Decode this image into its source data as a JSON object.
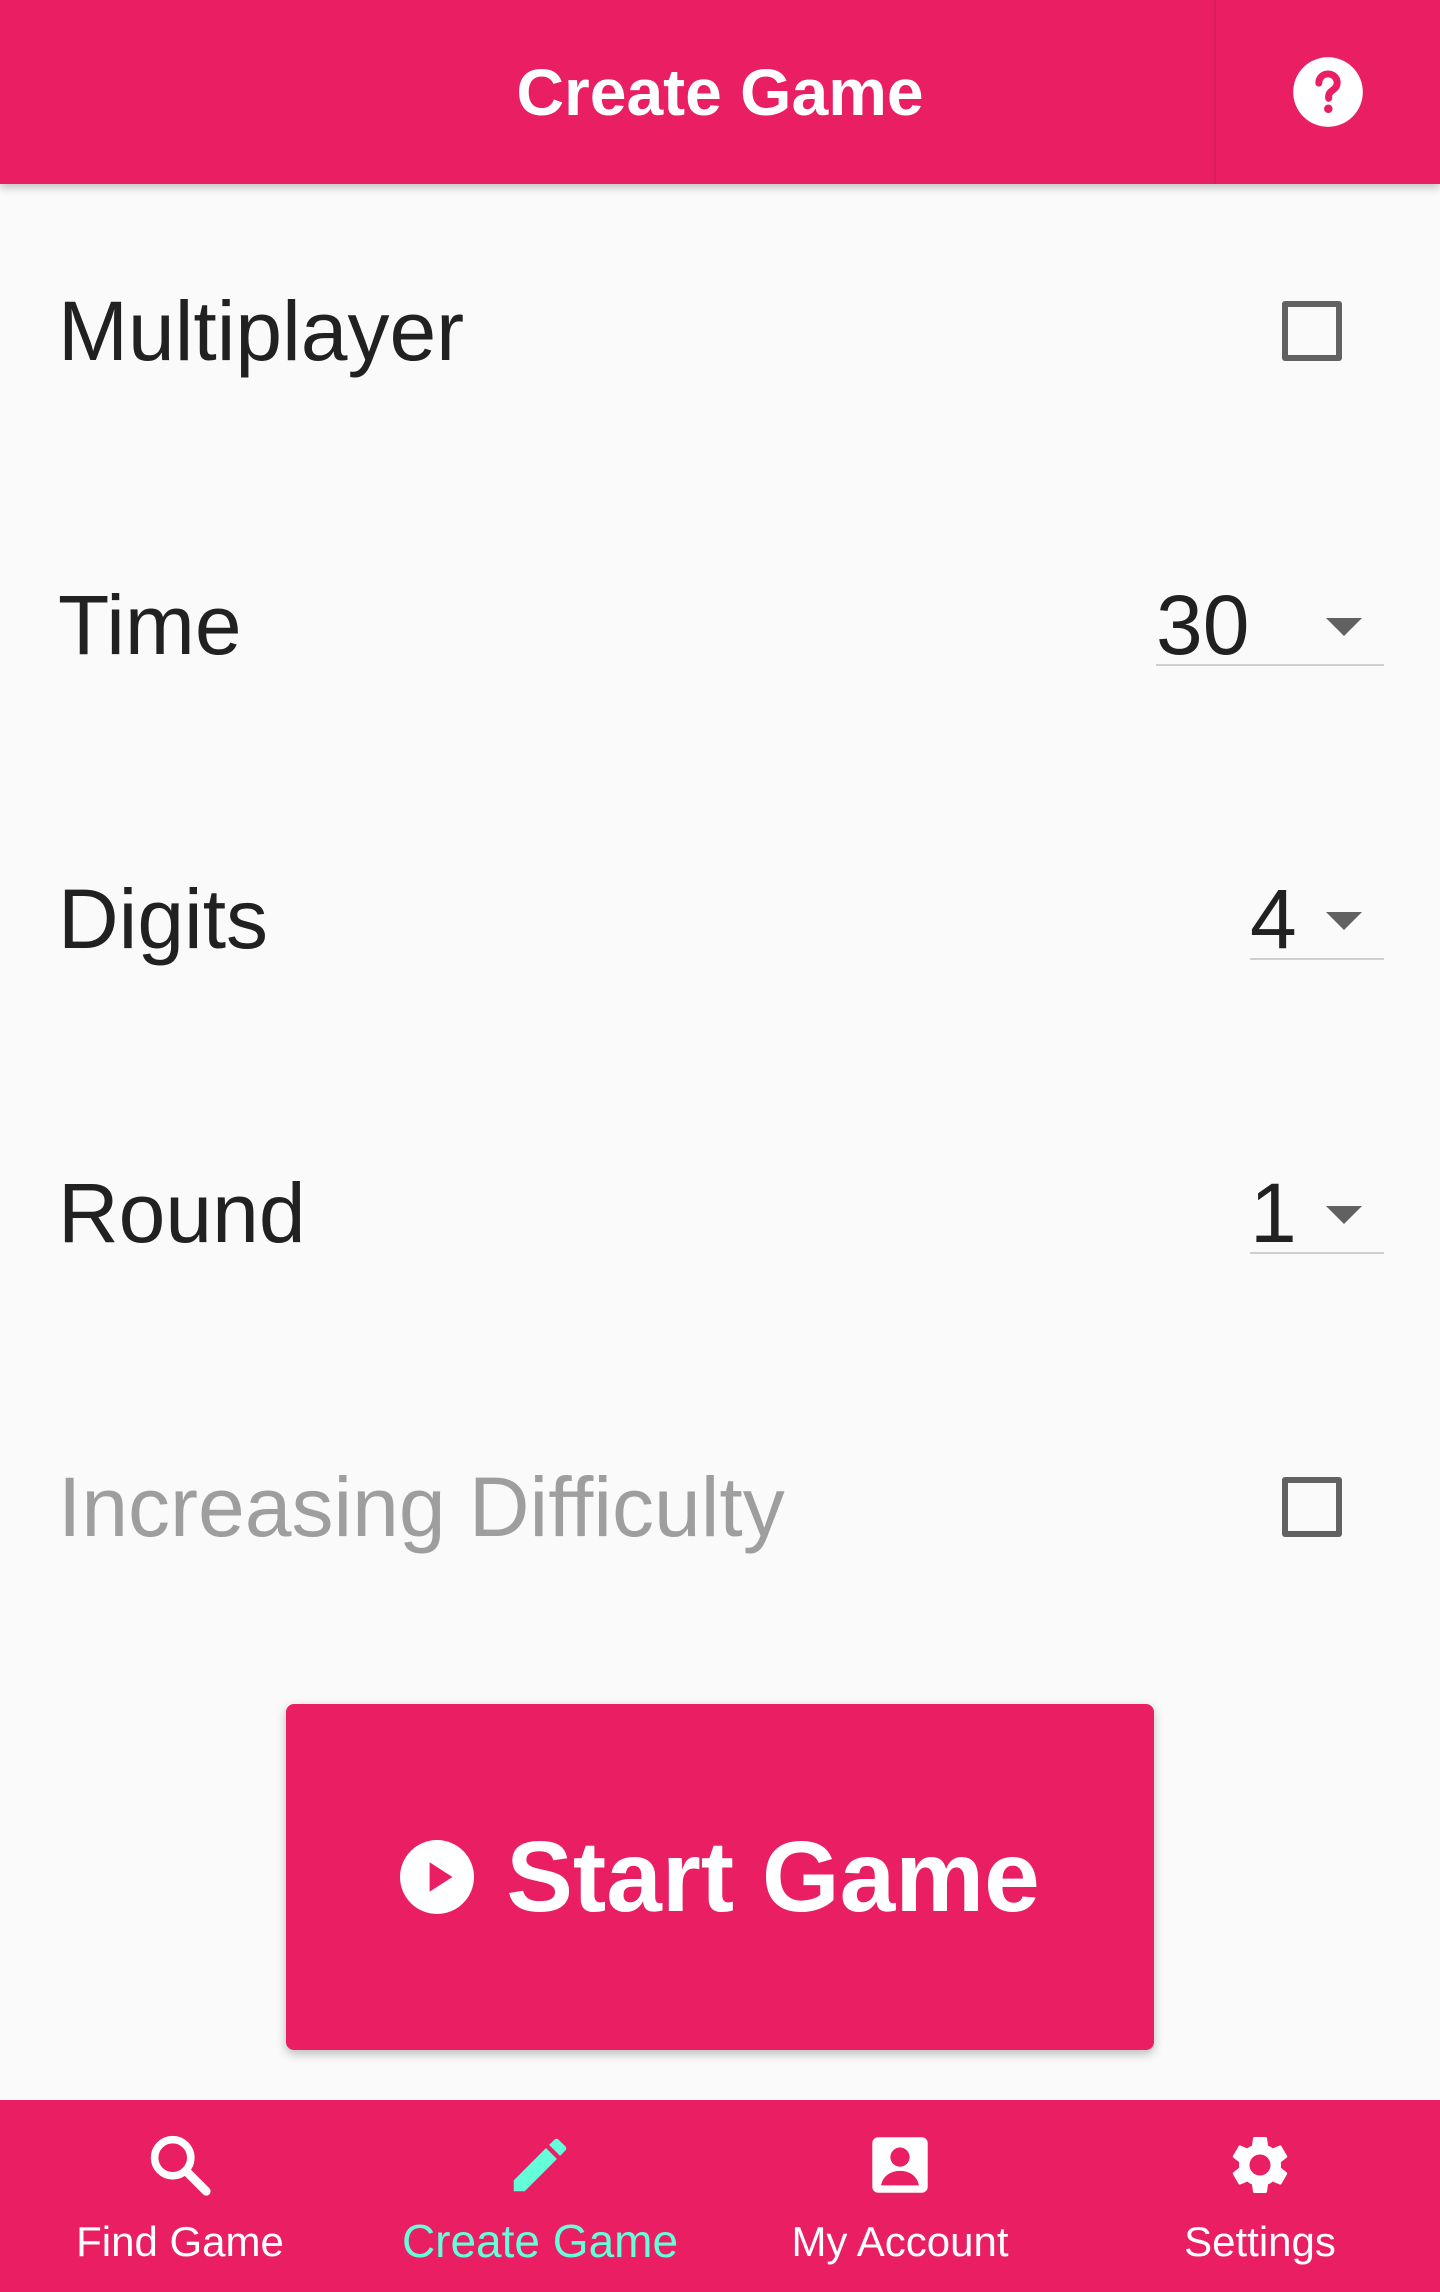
{
  "header": {
    "title": "Create Game",
    "help_icon": "help-circle-icon"
  },
  "options": {
    "multiplayer": {
      "label": "Multiplayer",
      "checked": false
    },
    "time": {
      "label": "Time",
      "value": "30"
    },
    "digits": {
      "label": "Digits",
      "value": "4"
    },
    "round": {
      "label": "Round",
      "value": "1"
    },
    "increasing_difficulty": {
      "label": "Increasing Difficulty",
      "checked": false,
      "disabled": true
    }
  },
  "start_button": {
    "label": "Start Game",
    "icon": "play-circle-icon"
  },
  "bottom_nav": {
    "items": [
      {
        "label": "Find Game",
        "icon": "search-icon",
        "active": false
      },
      {
        "label": "Create Game",
        "icon": "pencil-icon",
        "active": true
      },
      {
        "label": "My Account",
        "icon": "account-box-icon",
        "active": false
      },
      {
        "label": "Settings",
        "icon": "gear-icon",
        "active": false
      }
    ]
  },
  "colors": {
    "primary": "#e91e63",
    "accent": "#64ffda",
    "background": "#fafafa",
    "text": "#212121",
    "disabled_text": "#9e9e9e"
  }
}
